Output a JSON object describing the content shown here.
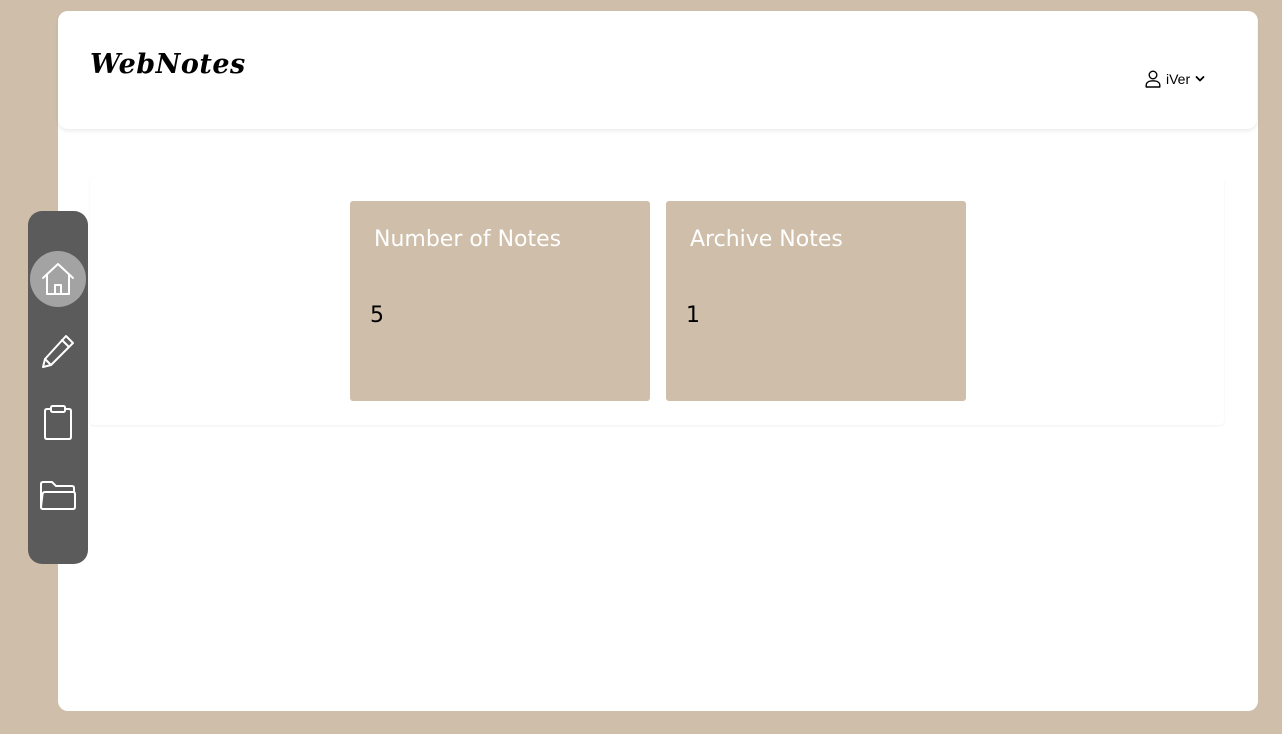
{
  "app": {
    "brand": "WebNotes"
  },
  "header": {
    "user": {
      "name": "iVer",
      "icon": "user-icon",
      "caret_icon": "chevron-down-icon"
    }
  },
  "sidebar": {
    "items": [
      {
        "name": "home",
        "icon": "home-icon",
        "active": true
      },
      {
        "name": "edit",
        "icon": "pencil-icon",
        "active": false
      },
      {
        "name": "notes",
        "icon": "clipboard-icon",
        "active": false
      },
      {
        "name": "archive",
        "icon": "folder-icon",
        "active": false
      }
    ]
  },
  "stats": [
    {
      "title": "Number of Notes",
      "value": "5"
    },
    {
      "title": "Archive Notes",
      "value": "1"
    }
  ],
  "colors": {
    "background": "#cfbfaa",
    "card": "#cfbfaa",
    "sidebar": "#5b5b5b",
    "sidebar_active": "#a3a3a3"
  }
}
